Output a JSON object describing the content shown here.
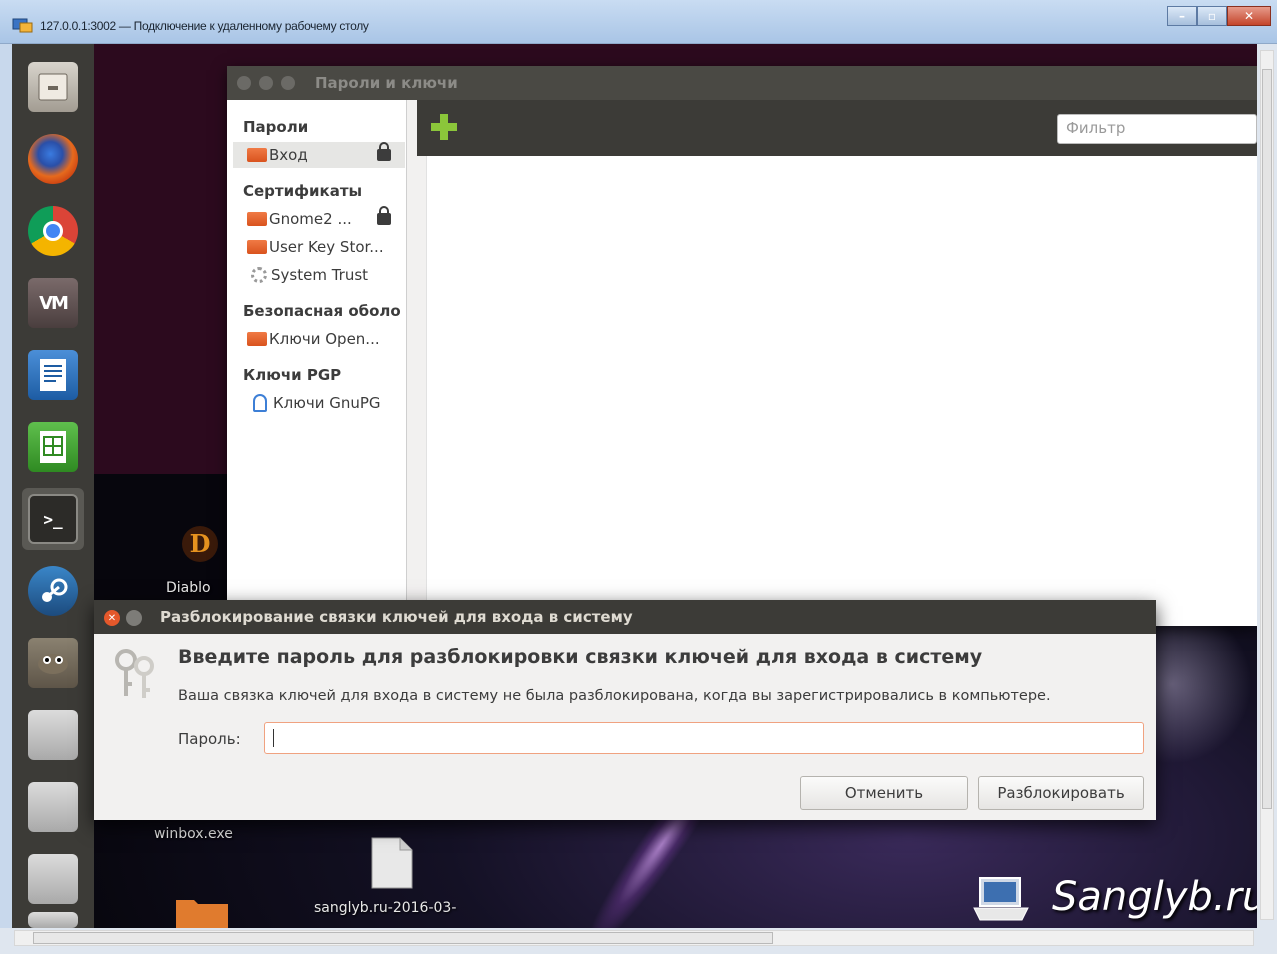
{
  "rdp": {
    "title": "127.0.0.1:3002 — Подключение к удаленному рабочему столу",
    "window_buttons": [
      "–",
      "▫",
      "✕"
    ]
  },
  "launcher": {
    "items": [
      "files-icon",
      "firefox-icon",
      "chrome-icon",
      "vm-icon",
      "writer-icon",
      "calc-icon",
      "terminal-icon",
      "steam-icon",
      "gimp-icon",
      "drive-icon",
      "drive-icon",
      "drive-icon",
      "drive-icon"
    ]
  },
  "desktop": {
    "icons": [
      {
        "label": "Diablo"
      },
      {
        "label": "winbox.exe"
      },
      {
        "label": "sanglyb.ru-2016-03-"
      }
    ]
  },
  "passwords_window": {
    "title": "Пароли и ключи",
    "filter_placeholder": "Фильтр",
    "sections": [
      {
        "label": "Пароли",
        "items": [
          {
            "label": "Вход",
            "locked": true,
            "selected": true
          }
        ]
      },
      {
        "label": "Сертификаты",
        "items": [
          {
            "label": "Gnome2 ...",
            "locked": true
          },
          {
            "label": "User Key Stor...",
            "locked": false
          },
          {
            "label": "System Trust",
            "locked": false
          }
        ]
      },
      {
        "label": "Безопасная оболо",
        "items": [
          {
            "label": "Ключи Open...",
            "locked": false
          }
        ]
      },
      {
        "label": "Ключи PGP",
        "items": [
          {
            "label": "Ключи GnuPG",
            "locked": false
          }
        ]
      }
    ]
  },
  "unlock_dialog": {
    "title": "Разблокирование связки ключей для входа в систему",
    "heading": "Введите пароль для разблокировки связки ключей для входа в систему",
    "message": "Ваша связка ключей для входа в систему не была разблокирована, когда вы зарегистрировались в компьютере.",
    "password_label": "Пароль:",
    "password_value": "",
    "cancel_label": "Отменить",
    "unlock_label": "Разблокировать"
  },
  "watermark": "Sanglyb.ru",
  "colors": {
    "unity_panel": "#3c3b37",
    "accent_orange": "#e4582b",
    "add_green": "#8bc63a"
  }
}
